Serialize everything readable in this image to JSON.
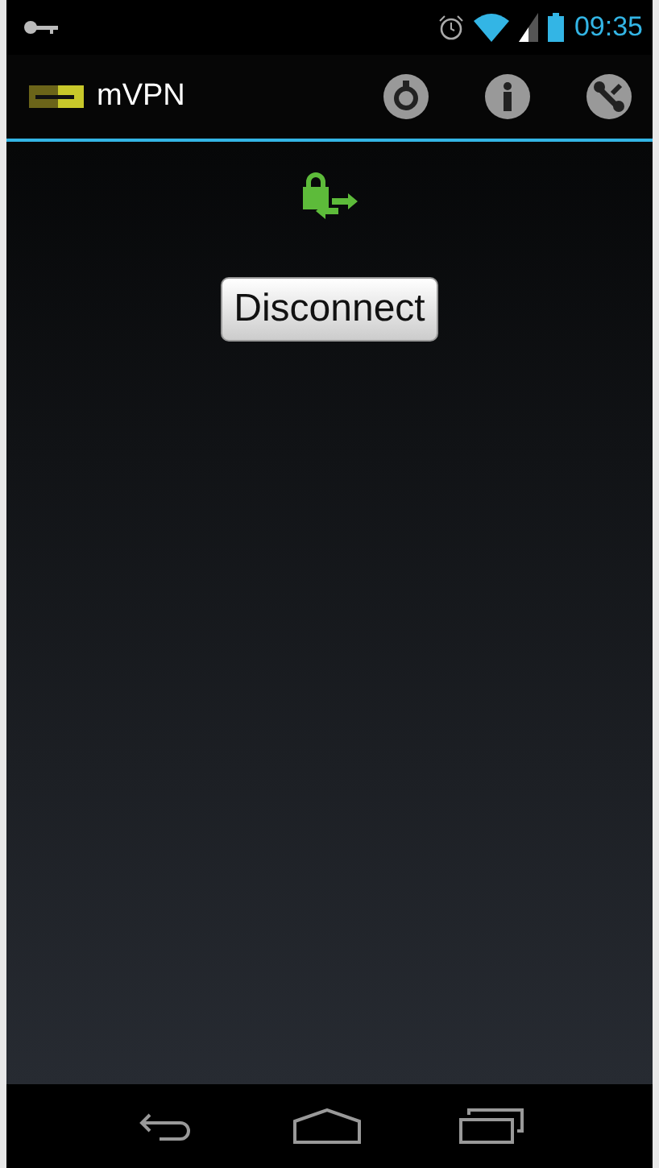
{
  "status_bar": {
    "time": "09:35"
  },
  "action_bar": {
    "title": "mVPN"
  },
  "main": {
    "button": "Disconnect"
  }
}
